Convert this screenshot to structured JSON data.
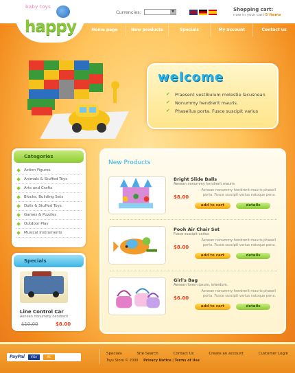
{
  "header": {
    "logo_small": "baby toys",
    "logo_text": "happy",
    "currencies_label": "Currencies:",
    "currency_value": "",
    "cart_title": "Shopping cart:",
    "cart_sub_prefix": "now in your cart",
    "cart_count": "5 items"
  },
  "nav": [
    "Home page",
    "New products",
    "Specials",
    "My account",
    "Contact us"
  ],
  "welcome": {
    "title": "welcome",
    "items": [
      "Praesent vestibulum molestie lacusnean",
      "Nonummy hendrerit mauris.",
      "Phasellus porta. Fusce suscipit varius"
    ]
  },
  "categories": {
    "title": "Categories",
    "items": [
      "Action Figures",
      "Animals & Stuffed Toys",
      "Arts and Crafts",
      "Blocks, Building Sets",
      "Dolls & Stuffed Toys",
      "Games & Puzzles",
      "Outdoor Play",
      "Musical Instruments"
    ]
  },
  "specials": {
    "title": "Specials",
    "name": "Line Control Car",
    "desc": "Aenean nonummy hendrerit",
    "old_price": "$10.00",
    "new_price": "$8.00"
  },
  "new_products": {
    "title": "New Products",
    "items": [
      {
        "name": "Bright Slide Balls",
        "sub": "Aenean nonummy hendrerit mauris",
        "desc": "Aenean nonummy hendrerit mauris phasell porta. Fusce suscipit varius natoque pena.",
        "price": "$8.00",
        "cart": "add to cart",
        "details": "details"
      },
      {
        "name": "Pooh Air Chair Set",
        "sub": "Fusce suscipit varius",
        "desc": "Aenean nonummy hendrerit mauris phasell porta. Fusce suscipit varius natoque pena.",
        "price": "$8.00",
        "cart": "add to cart",
        "details": "details"
      },
      {
        "name": "Girl's Bag",
        "sub": "Aenean lorem ipsum, interdum.",
        "desc": "Aenean nonummy hendrerit mauris phasell porta. Fusce suscipit varius natoque pena.",
        "price": "$6.00",
        "cart": "add to cart",
        "details": "details"
      }
    ]
  },
  "footer": {
    "payment": "PayPal",
    "cards": [
      "VISA",
      "MC"
    ],
    "links": [
      "Specials",
      "Site Search",
      "Contact Us",
      "Create an account",
      "Customer Login"
    ],
    "copyright": "Toys Store © 2008",
    "privacy": "Privacy Notice",
    "terms": "Terms of Use"
  }
}
